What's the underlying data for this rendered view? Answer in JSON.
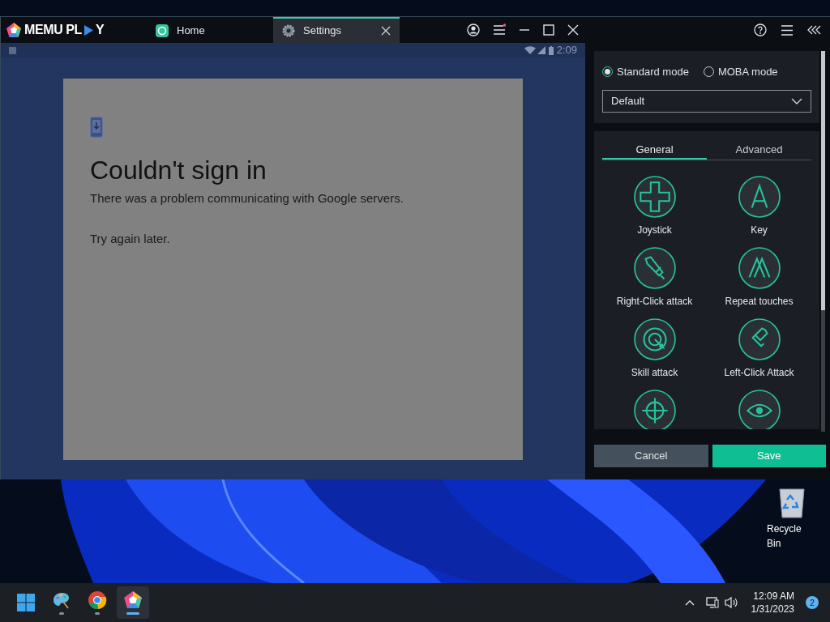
{
  "window": {
    "logo": {
      "before": "MEMU PL",
      "after": "Y"
    },
    "tabs": [
      {
        "label": "Home",
        "kind": "home",
        "selected": false
      },
      {
        "label": "Settings",
        "kind": "settings",
        "selected": true
      }
    ]
  },
  "android": {
    "clock": "2:09",
    "dialog": {
      "title": "Couldn't sign in",
      "message": "There was a problem communicating with Google servers.",
      "hint": "Try again later."
    }
  },
  "keymap_panel": {
    "modes": [
      {
        "label": "Standard mode",
        "selected": true
      },
      {
        "label": "MOBA mode",
        "selected": false
      }
    ],
    "preset": "Default",
    "tabs": [
      {
        "label": "General",
        "selected": true
      },
      {
        "label": "Advanced",
        "selected": false
      }
    ],
    "controls": [
      {
        "kind": "joystick",
        "label": "Joystick"
      },
      {
        "kind": "key",
        "label": "Key"
      },
      {
        "kind": "sword",
        "label": "Right-Click attack"
      },
      {
        "kind": "repeat",
        "label": "Repeat touches"
      },
      {
        "kind": "target",
        "label": "Skill attack"
      },
      {
        "kind": "bullet",
        "label": "Left-Click Attack"
      },
      {
        "kind": "crosshair"
      },
      {
        "kind": "eye"
      }
    ],
    "buttons": [
      {
        "kind": "cancel",
        "label": "Cancel"
      },
      {
        "kind": "save",
        "label": "Save"
      }
    ]
  },
  "desktop": {
    "icons": [
      {
        "label": "Recycle Bin"
      }
    ]
  },
  "taskbar": {
    "apps": [
      {
        "kind": "paint",
        "selected": false
      },
      {
        "kind": "chrome",
        "selected": false
      },
      {
        "kind": "memu",
        "selected": true
      }
    ],
    "time": "12:09 AM",
    "date": "1/31/2023",
    "notifications": "2"
  }
}
